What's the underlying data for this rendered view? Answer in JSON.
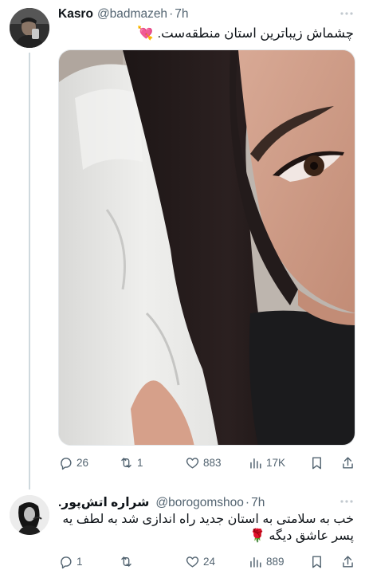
{
  "tweets": [
    {
      "author_name": "Kasro",
      "handle": "@badmazeh",
      "separator": "·",
      "time": "7h",
      "text": "چشماش زیباترین استان منطقه‌ست.",
      "emoji": "💘",
      "actions": {
        "replies": "26",
        "retweets": "1",
        "likes": "883",
        "views": "17K"
      }
    },
    {
      "author_name": "شراره اتش‌پور.",
      "handle": "@borogomshoo",
      "separator": "·",
      "time": "7h",
      "text_lines": [
        "خب به سلامتی به استان جدید راه اندازی شد به لطف یه",
        "پسر عاشق دیگه 🌹"
      ],
      "actions": {
        "replies": "1",
        "retweets": "",
        "likes": "24",
        "views": "889"
      }
    }
  ],
  "colors": {
    "secondary_text": "#536471",
    "primary_text": "#0f1419",
    "thread_line": "#cfd9de",
    "emoji_heart": "#e0245e"
  },
  "icons": [
    "more-icon",
    "reply-icon",
    "retweet-icon",
    "like-icon",
    "views-icon",
    "bookmark-icon",
    "share-icon"
  ]
}
